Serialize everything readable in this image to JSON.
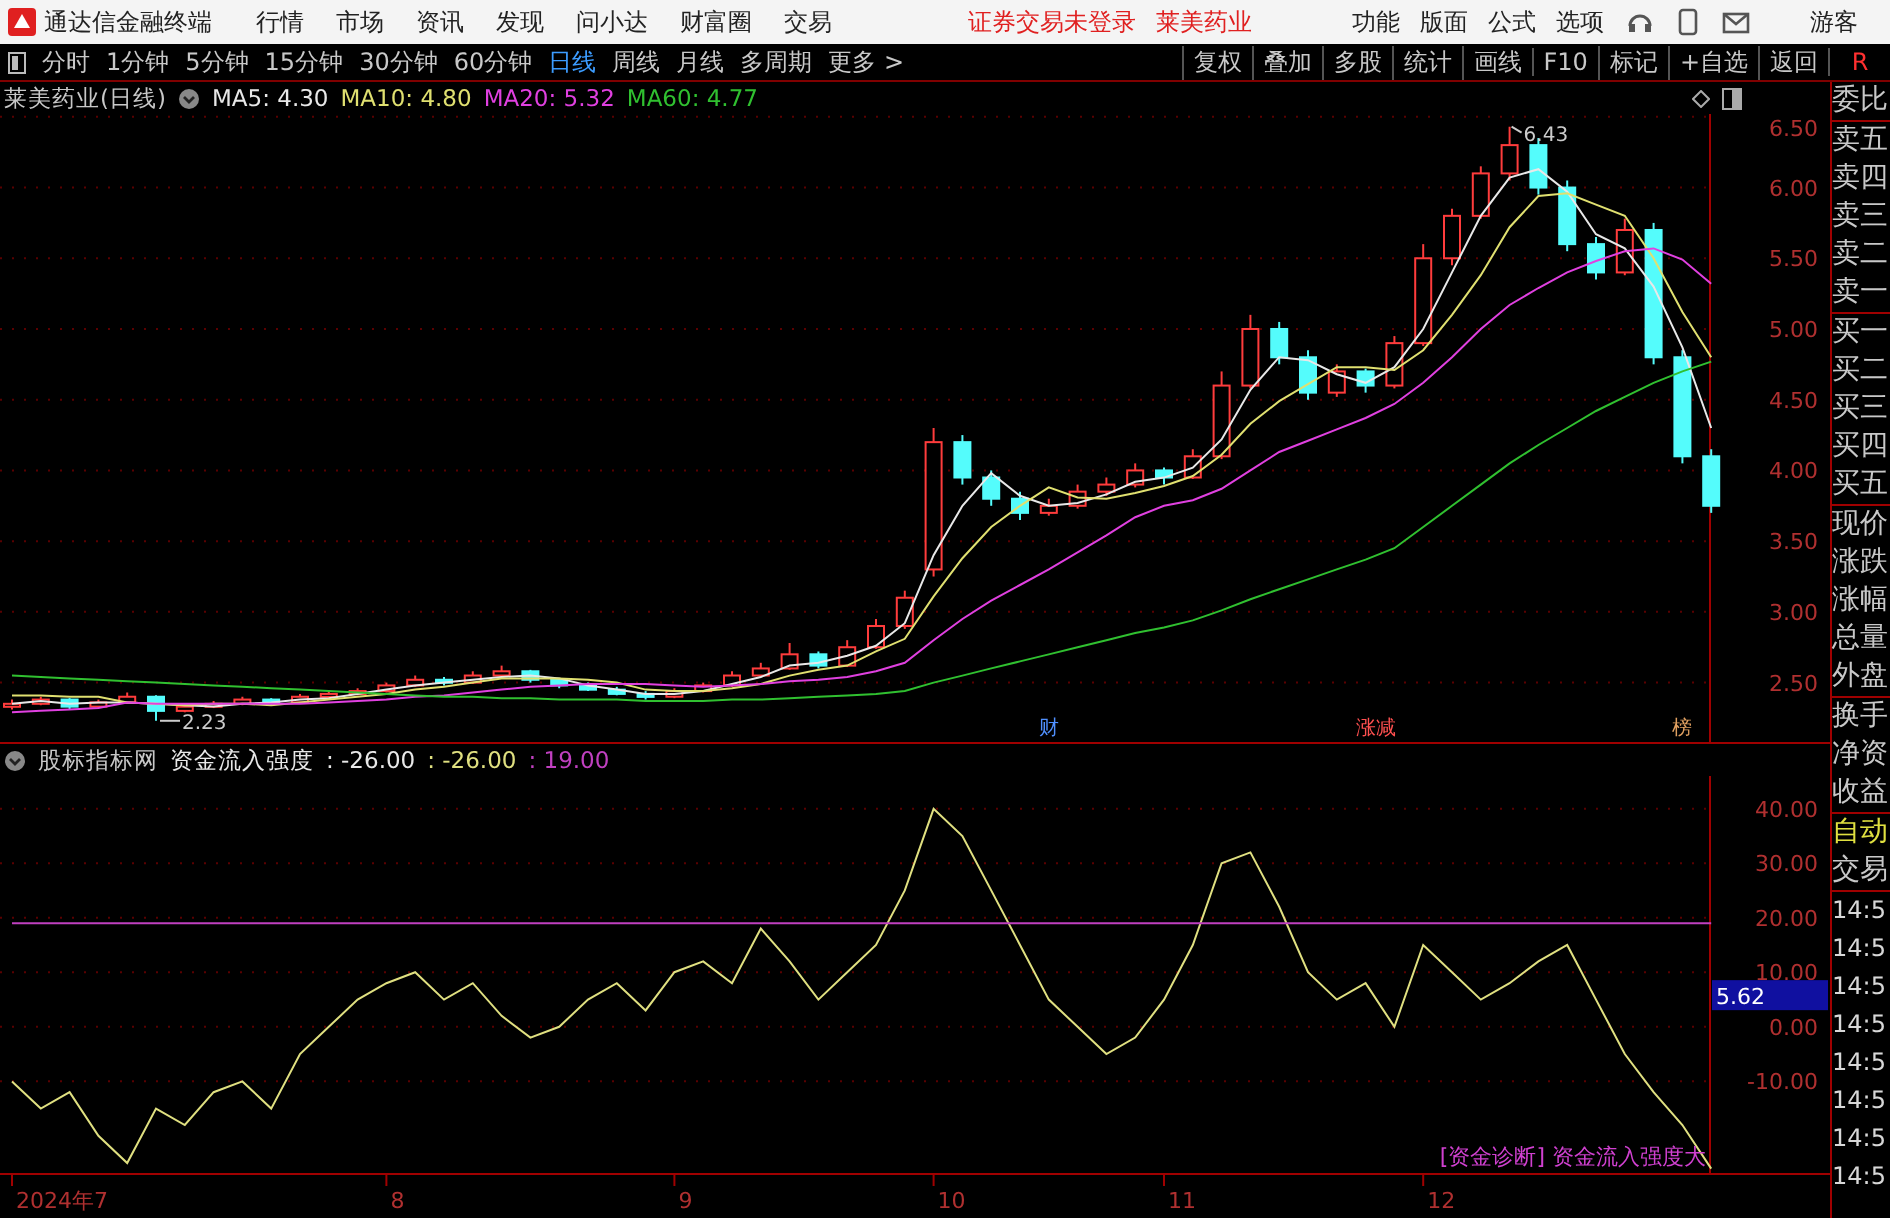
{
  "app_bar": {
    "title": "通达信金融终端",
    "menu": [
      "行情",
      "市场",
      "资讯",
      "发现",
      "问小达",
      "财富圈",
      "交易"
    ],
    "notice": "证券交易未登录",
    "stock": "莱美药业",
    "tools": [
      "功能",
      "版面",
      "公式",
      "选项"
    ],
    "user": "游客"
  },
  "period_bar": {
    "periods": [
      {
        "label": "分时",
        "selected": false
      },
      {
        "label": "1分钟",
        "selected": false
      },
      {
        "label": "5分钟",
        "selected": false
      },
      {
        "label": "15分钟",
        "selected": false
      },
      {
        "label": "30分钟",
        "selected": false
      },
      {
        "label": "60分钟",
        "selected": false
      },
      {
        "label": "日线",
        "selected": true
      },
      {
        "label": "周线",
        "selected": false
      },
      {
        "label": "月线",
        "selected": false
      },
      {
        "label": "多周期",
        "selected": false
      },
      {
        "label": "更多 >",
        "selected": false
      }
    ],
    "buttons": [
      "复权",
      "叠加",
      "多股",
      "统计",
      "画线",
      "F10",
      "标记",
      "+自选",
      "返回"
    ],
    "corner": "R"
  },
  "price_pane": {
    "title": "莱美药业(日线)",
    "legend": [
      ": 4.30",
      ": 4.80",
      ": 5.32",
      ": 4.77"
    ],
    "chart_data": {
      "type": "candlestick",
      "grid": true,
      "ylim": [
        2.08,
        6.52
      ],
      "yticks": [
        {
          "value": 6.5,
          "label": "6.50"
        },
        {
          "value": 6,
          "label": "6.00"
        },
        {
          "value": 5.5,
          "label": "5.50"
        },
        {
          "value": 5,
          "label": "5.00"
        },
        {
          "value": 4.5,
          "label": "4.50"
        },
        {
          "value": 4,
          "label": "4.00"
        },
        {
          "value": 3.5,
          "label": "3.50"
        },
        {
          "value": 3,
          "label": "3.00"
        },
        {
          "value": 2.5,
          "label": "2.50"
        }
      ],
      "ohlc": [
        [
          2.33,
          2.38,
          2.31,
          2.35
        ],
        [
          2.35,
          2.4,
          2.34,
          2.38
        ],
        [
          2.38,
          2.39,
          2.31,
          2.33
        ],
        [
          2.33,
          2.38,
          2.32,
          2.36
        ],
        [
          2.36,
          2.43,
          2.35,
          2.4
        ],
        [
          2.4,
          2.41,
          2.23,
          2.3
        ],
        [
          2.3,
          2.35,
          2.29,
          2.33
        ],
        [
          2.33,
          2.37,
          2.32,
          2.35
        ],
        [
          2.35,
          2.4,
          2.34,
          2.38
        ],
        [
          2.38,
          2.39,
          2.34,
          2.36
        ],
        [
          2.36,
          2.42,
          2.35,
          2.4
        ],
        [
          2.4,
          2.44,
          2.39,
          2.42
        ],
        [
          2.42,
          2.46,
          2.41,
          2.44
        ],
        [
          2.44,
          2.5,
          2.43,
          2.48
        ],
        [
          2.48,
          2.55,
          2.47,
          2.52
        ],
        [
          2.52,
          2.54,
          2.48,
          2.5
        ],
        [
          2.5,
          2.58,
          2.49,
          2.55
        ],
        [
          2.55,
          2.62,
          2.54,
          2.58
        ],
        [
          2.58,
          2.59,
          2.5,
          2.52
        ],
        [
          2.52,
          2.53,
          2.46,
          2.48
        ],
        [
          2.48,
          2.5,
          2.44,
          2.45
        ],
        [
          2.45,
          2.47,
          2.41,
          2.42
        ],
        [
          2.42,
          2.44,
          2.38,
          2.4
        ],
        [
          2.4,
          2.46,
          2.39,
          2.44
        ],
        [
          2.44,
          2.5,
          2.43,
          2.48
        ],
        [
          2.48,
          2.58,
          2.47,
          2.55
        ],
        [
          2.55,
          2.64,
          2.54,
          2.6
        ],
        [
          2.6,
          2.78,
          2.59,
          2.7
        ],
        [
          2.7,
          2.72,
          2.6,
          2.62
        ],
        [
          2.62,
          2.8,
          2.61,
          2.75
        ],
        [
          2.75,
          2.95,
          2.74,
          2.9
        ],
        [
          2.9,
          3.15,
          2.88,
          3.1
        ],
        [
          3.3,
          4.3,
          3.25,
          4.2
        ],
        [
          4.2,
          4.25,
          3.9,
          3.95
        ],
        [
          3.95,
          4.0,
          3.75,
          3.8
        ],
        [
          3.8,
          3.85,
          3.65,
          3.7
        ],
        [
          3.7,
          3.8,
          3.68,
          3.75
        ],
        [
          3.75,
          3.9,
          3.73,
          3.85
        ],
        [
          3.85,
          3.95,
          3.82,
          3.9
        ],
        [
          3.9,
          4.05,
          3.88,
          4.0
        ],
        [
          4.0,
          4.02,
          3.9,
          3.95
        ],
        [
          3.95,
          4.15,
          3.94,
          4.1
        ],
        [
          4.1,
          4.7,
          4.08,
          4.6
        ],
        [
          4.6,
          5.1,
          4.58,
          5.0
        ],
        [
          5.0,
          5.05,
          4.75,
          4.8
        ],
        [
          4.8,
          4.85,
          4.5,
          4.55
        ],
        [
          4.55,
          4.75,
          4.52,
          4.7
        ],
        [
          4.7,
          4.72,
          4.55,
          4.6
        ],
        [
          4.6,
          4.95,
          4.58,
          4.9
        ],
        [
          4.9,
          5.6,
          4.88,
          5.5
        ],
        [
          5.5,
          5.85,
          5.45,
          5.8
        ],
        [
          5.8,
          6.15,
          5.78,
          6.1
        ],
        [
          6.1,
          6.43,
          6.05,
          6.3
        ],
        [
          6.3,
          6.35,
          5.95,
          6.0
        ],
        [
          6.0,
          6.05,
          5.55,
          5.6
        ],
        [
          5.6,
          5.65,
          5.35,
          5.4
        ],
        [
          5.4,
          5.78,
          5.38,
          5.7
        ],
        [
          5.7,
          5.75,
          4.75,
          4.8
        ],
        [
          4.8,
          4.85,
          4.05,
          4.1
        ],
        [
          4.1,
          4.15,
          3.7,
          3.75
        ]
      ],
      "series": [
        {
          "name": "MA5",
          "type": "line",
          "color": "#e8e8e8",
          "values": [
            2.35,
            2.37,
            2.35,
            2.36,
            2.36,
            2.35,
            2.34,
            2.33,
            2.35,
            2.36,
            2.38,
            2.39,
            2.42,
            2.45,
            2.48,
            2.5,
            2.52,
            2.54,
            2.55,
            2.53,
            2.48,
            2.45,
            2.42,
            2.42,
            2.44,
            2.49,
            2.54,
            2.62,
            2.64,
            2.69,
            2.76,
            2.92,
            3.4,
            3.75,
            3.98,
            3.82,
            3.75,
            3.77,
            3.83,
            3.92,
            3.95,
            4.02,
            4.22,
            4.57,
            4.8,
            4.78,
            4.68,
            4.62,
            4.73,
            5.0,
            5.4,
            5.8,
            6.07,
            6.13,
            5.97,
            5.67,
            5.57,
            5.3,
            4.87,
            4.3
          ]
        },
        {
          "name": "MA10",
          "type": "line",
          "color": "#e0e070",
          "values": [
            2.41,
            2.41,
            2.4,
            2.4,
            2.36,
            2.35,
            2.34,
            2.35,
            2.35,
            2.34,
            2.36,
            2.38,
            2.4,
            2.42,
            2.45,
            2.47,
            2.5,
            2.53,
            2.53,
            2.53,
            2.52,
            2.5,
            2.45,
            2.44,
            2.44,
            2.46,
            2.49,
            2.55,
            2.59,
            2.62,
            2.72,
            2.81,
            3.11,
            3.38,
            3.6,
            3.75,
            3.88,
            3.81,
            3.8,
            3.84,
            3.89,
            3.96,
            4.11,
            4.33,
            4.49,
            4.61,
            4.73,
            4.73,
            4.71,
            4.85,
            5.1,
            5.38,
            5.72,
            5.94,
            5.96,
            5.88,
            5.8,
            5.5,
            5.12,
            4.8
          ]
        },
        {
          "name": "MA20",
          "type": "line",
          "color": "#e040e0",
          "values": [
            2.29,
            2.3,
            2.31,
            2.32,
            2.36,
            2.35,
            2.35,
            2.35,
            2.35,
            2.35,
            2.35,
            2.36,
            2.37,
            2.38,
            2.4,
            2.41,
            2.43,
            2.45,
            2.47,
            2.48,
            2.49,
            2.49,
            2.49,
            2.48,
            2.47,
            2.48,
            2.49,
            2.51,
            2.52,
            2.54,
            2.58,
            2.64,
            2.8,
            2.95,
            3.08,
            3.19,
            3.3,
            3.42,
            3.54,
            3.67,
            3.75,
            3.79,
            3.87,
            4.0,
            4.13,
            4.21,
            4.29,
            4.37,
            4.47,
            4.62,
            4.8,
            5.0,
            5.17,
            5.29,
            5.4,
            5.48,
            5.55,
            5.57,
            5.49,
            5.32
          ]
        },
        {
          "name": "MA60",
          "type": "line",
          "color": "#30c030",
          "values": [
            2.55,
            2.54,
            2.53,
            2.52,
            2.51,
            2.5,
            2.49,
            2.48,
            2.47,
            2.46,
            2.45,
            2.44,
            2.43,
            2.42,
            2.41,
            2.4,
            2.4,
            2.39,
            2.39,
            2.38,
            2.38,
            2.38,
            2.37,
            2.37,
            2.37,
            2.38,
            2.38,
            2.39,
            2.4,
            2.41,
            2.42,
            2.44,
            2.5,
            2.55,
            2.6,
            2.65,
            2.7,
            2.75,
            2.8,
            2.85,
            2.89,
            2.94,
            3.01,
            3.09,
            3.16,
            3.23,
            3.3,
            3.37,
            3.45,
            3.6,
            3.75,
            3.9,
            4.05,
            4.18,
            4.3,
            4.42,
            4.52,
            4.62,
            4.7,
            4.77
          ]
        }
      ],
      "annotations": [
        {
          "text": "6.43"
        },
        {
          "text": "2.23"
        }
      ]
    },
    "event_tags": [
      {
        "text": "财",
        "color": "#5090ff"
      },
      {
        "text": "涨减",
        "color": "#ff5050"
      },
      {
        "text": "榜",
        "color": "#e0a060"
      }
    ]
  },
  "indicator_pane": {
    "source": "股标指标网",
    "readings": [
      {
        "text": ": -26.00",
        "color": "#e8e8e8"
      },
      {
        "text": ": -26.00",
        "color": "#e0e080"
      },
      {
        "text": ": 19.00",
        "color": "#c040c0"
      }
    ],
    "cursor_value": "5.62",
    "chart_data": {
      "type": "line",
      "grid": true,
      "ylim": [
        -27,
        46
      ],
      "yticks": [
        {
          "value": 40,
          "label": "40.00"
        },
        {
          "value": 30,
          "label": "30.00"
        },
        {
          "value": 20,
          "label": "20.00"
        },
        {
          "value": 10,
          "label": "10.00"
        },
        {
          "value": 0,
          "label": "0.00"
        },
        {
          "value": -10,
          "label": "-10.00"
        }
      ],
      "series": [
        {
          "name": "资金流入强度",
          "color": "#e0e080",
          "values": [
            -10,
            -15,
            -12,
            -20,
            -25,
            -15,
            -18,
            -12,
            -10,
            -15,
            -5,
            0,
            5,
            8,
            10,
            5,
            8,
            2,
            -2,
            0,
            5,
            8,
            3,
            10,
            12,
            8,
            18,
            12,
            5,
            10,
            15,
            25,
            40,
            35,
            25,
            15,
            5,
            0,
            -5,
            -2,
            5,
            15,
            30,
            32,
            22,
            10,
            5,
            8,
            0,
            15,
            10,
            5,
            8,
            12,
            15,
            5,
            -5,
            -12,
            -18,
            -26
          ]
        },
        {
          "color": "#c040c0",
          "values": [
            19,
            19,
            19,
            19,
            19,
            19,
            19,
            19,
            19,
            19,
            19,
            19,
            19,
            19,
            19,
            19,
            19,
            19,
            19,
            19,
            19,
            19,
            19,
            19,
            19,
            19,
            19,
            19,
            19,
            19,
            19,
            19,
            19,
            19,
            19,
            19,
            19,
            19,
            19,
            19,
            19,
            19,
            19,
            19,
            19,
            19,
            19,
            19,
            19,
            19,
            19,
            19,
            19,
            19,
            19,
            19,
            19,
            19,
            19,
            19
          ]
        }
      ]
    },
    "signal": {
      "tag": "[资金诊断]",
      "text": "资金流入强度大"
    }
  },
  "date_axis": [
    "2024年7",
    "8",
    "9",
    "10",
    "11",
    "12"
  ],
  "quote_panel": {
    "groups": [
      [
        "委比"
      ],
      [
        "卖五",
        "卖四",
        "卖三",
        "卖二",
        "卖一"
      ],
      [
        "买一",
        "买二",
        "买三",
        "买四",
        "买五"
      ],
      [
        "现价",
        "涨跌",
        "涨幅",
        "总量",
        "外盘"
      ],
      [
        "换手",
        "净资",
        "收益"
      ]
    ],
    "mode": "自动",
    "trade": "交易",
    "times": [
      "14:5",
      "14:5",
      "14:5",
      "14:5",
      "14:5",
      "14:5",
      "14:5",
      "14:5"
    ]
  }
}
